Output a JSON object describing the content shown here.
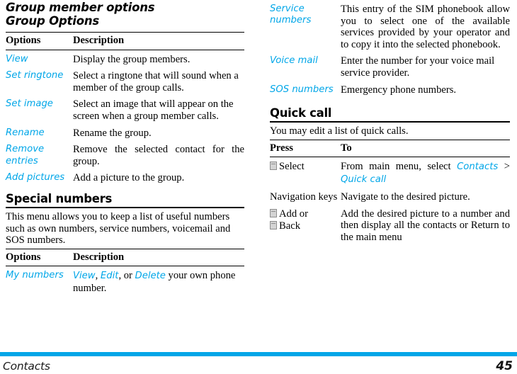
{
  "accent_color": "#00a6e8",
  "left_column": {
    "chapter_heading_1": "Group member options",
    "chapter_heading_2": "Group Options",
    "group_options_table": {
      "headers": [
        "Options",
        "Description"
      ],
      "rows": [
        {
          "option": "View",
          "description": "Display the group members."
        },
        {
          "option": "Set ringtone",
          "description": "Select a ringtone that will sound when a member of the group calls."
        },
        {
          "option": "Set image",
          "description": "Select an image that will appear on the screen when a group member calls."
        },
        {
          "option": "Rename",
          "description": "Rename the group."
        },
        {
          "option": "Remove entries",
          "description": "Remove the selected contact for the group."
        },
        {
          "option": "Add pictures",
          "description": "Add a picture to the group."
        }
      ]
    },
    "special_numbers": {
      "heading": "Special numbers",
      "intro": "This menu allows you to keep a list of useful numbers such as own numbers, service numbers, voicemail and SOS numbers.",
      "headers": [
        "Options",
        "Description"
      ],
      "rows": [
        {
          "option": "My numbers",
          "description_parts": [
            {
              "text": "View",
              "style": "term"
            },
            {
              "text": ", ",
              "style": "plain"
            },
            {
              "text": "Edit",
              "style": "term"
            },
            {
              "text": ", or ",
              "style": "plain"
            },
            {
              "text": "Delete",
              "style": "term"
            },
            {
              "text": " your own phone number.",
              "style": "plain"
            }
          ],
          "description_plain": "View, Edit, or Delete your own phone number."
        }
      ]
    }
  },
  "right_column": {
    "special_numbers_continued": {
      "rows": [
        {
          "option": "Service numbers",
          "description": "This entry of the SIM phonebook allow you to select one of the available services provided by your operator and to copy it into the selected phonebook."
        },
        {
          "option": "Voice mail",
          "description": "Enter the number for your voice mail service provider."
        },
        {
          "option": "SOS numbers",
          "description": "Emergency phone numbers."
        }
      ]
    },
    "quick_call": {
      "heading": "Quick call",
      "intro": "You may edit a list of quick calls.",
      "headers": [
        "Press",
        "To"
      ],
      "rows": [
        {
          "press_lines": [
            {
              "icon": "softkey-icon",
              "label": "Select"
            }
          ],
          "press_plain": "Select",
          "description_parts": [
            {
              "text": "From main menu, select ",
              "style": "plain"
            },
            {
              "text": "Contacts",
              "style": "term"
            },
            {
              "text": " > ",
              "style": "plain"
            },
            {
              "text": "Quick call",
              "style": "term"
            }
          ],
          "description_plain": "From main menu, select Contacts > Quick call"
        },
        {
          "press_lines": [
            {
              "icon": null,
              "label": "Navigation keys"
            }
          ],
          "press_plain": "Navigation keys",
          "description_parts": [
            {
              "text": "Navigate to the desired picture.",
              "style": "plain"
            }
          ],
          "description_plain": "Navigate to the desired picture."
        },
        {
          "press_lines": [
            {
              "icon": "softkey-icon",
              "label": "Add or"
            },
            {
              "icon": "softkey-icon",
              "label": "Back"
            }
          ],
          "press_plain": "Add or Back",
          "description_parts": [
            {
              "text": "Add the desired picture to a number and then display all the contacts or Return to the main menu",
              "style": "plain"
            }
          ],
          "description_plain": "Add the desired picture to a number and then display all the contacts or Return to the main menu"
        }
      ]
    }
  },
  "footer": {
    "chapter": "Contacts",
    "page_number": "45"
  }
}
